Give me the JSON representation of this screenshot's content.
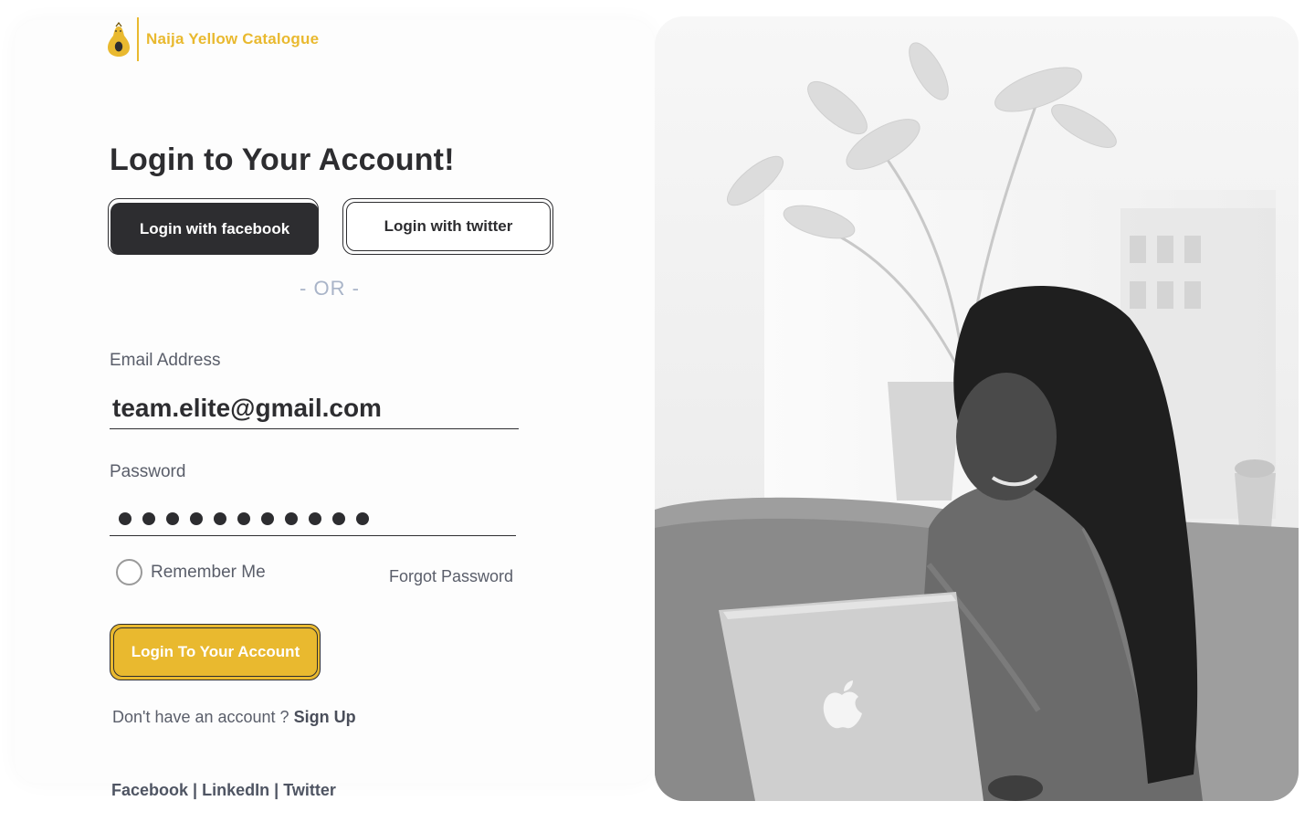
{
  "brand": {
    "name": "Naija Yellow Catalogue",
    "accent_color": "#e9b92f"
  },
  "login": {
    "heading": "Login to Your Account!",
    "facebook_button": "Login with facebook",
    "twitter_button": "Login with twitter",
    "divider_text": "- OR -",
    "email_label": "Email Address",
    "email_value": "team.elite@gmail.com",
    "password_label": "Password",
    "password_length": 11,
    "remember_label": "Remember Me",
    "forgot_label": "Forgot Password",
    "submit_button": "Login To Your Account",
    "signup_prompt": "Don't have an account ?",
    "signup_link": "Sign Up"
  },
  "footer": {
    "links": [
      "Facebook",
      "LinkedIn",
      "Twitter"
    ],
    "separator": "|"
  },
  "hero": {
    "icon": "apple-icon"
  }
}
